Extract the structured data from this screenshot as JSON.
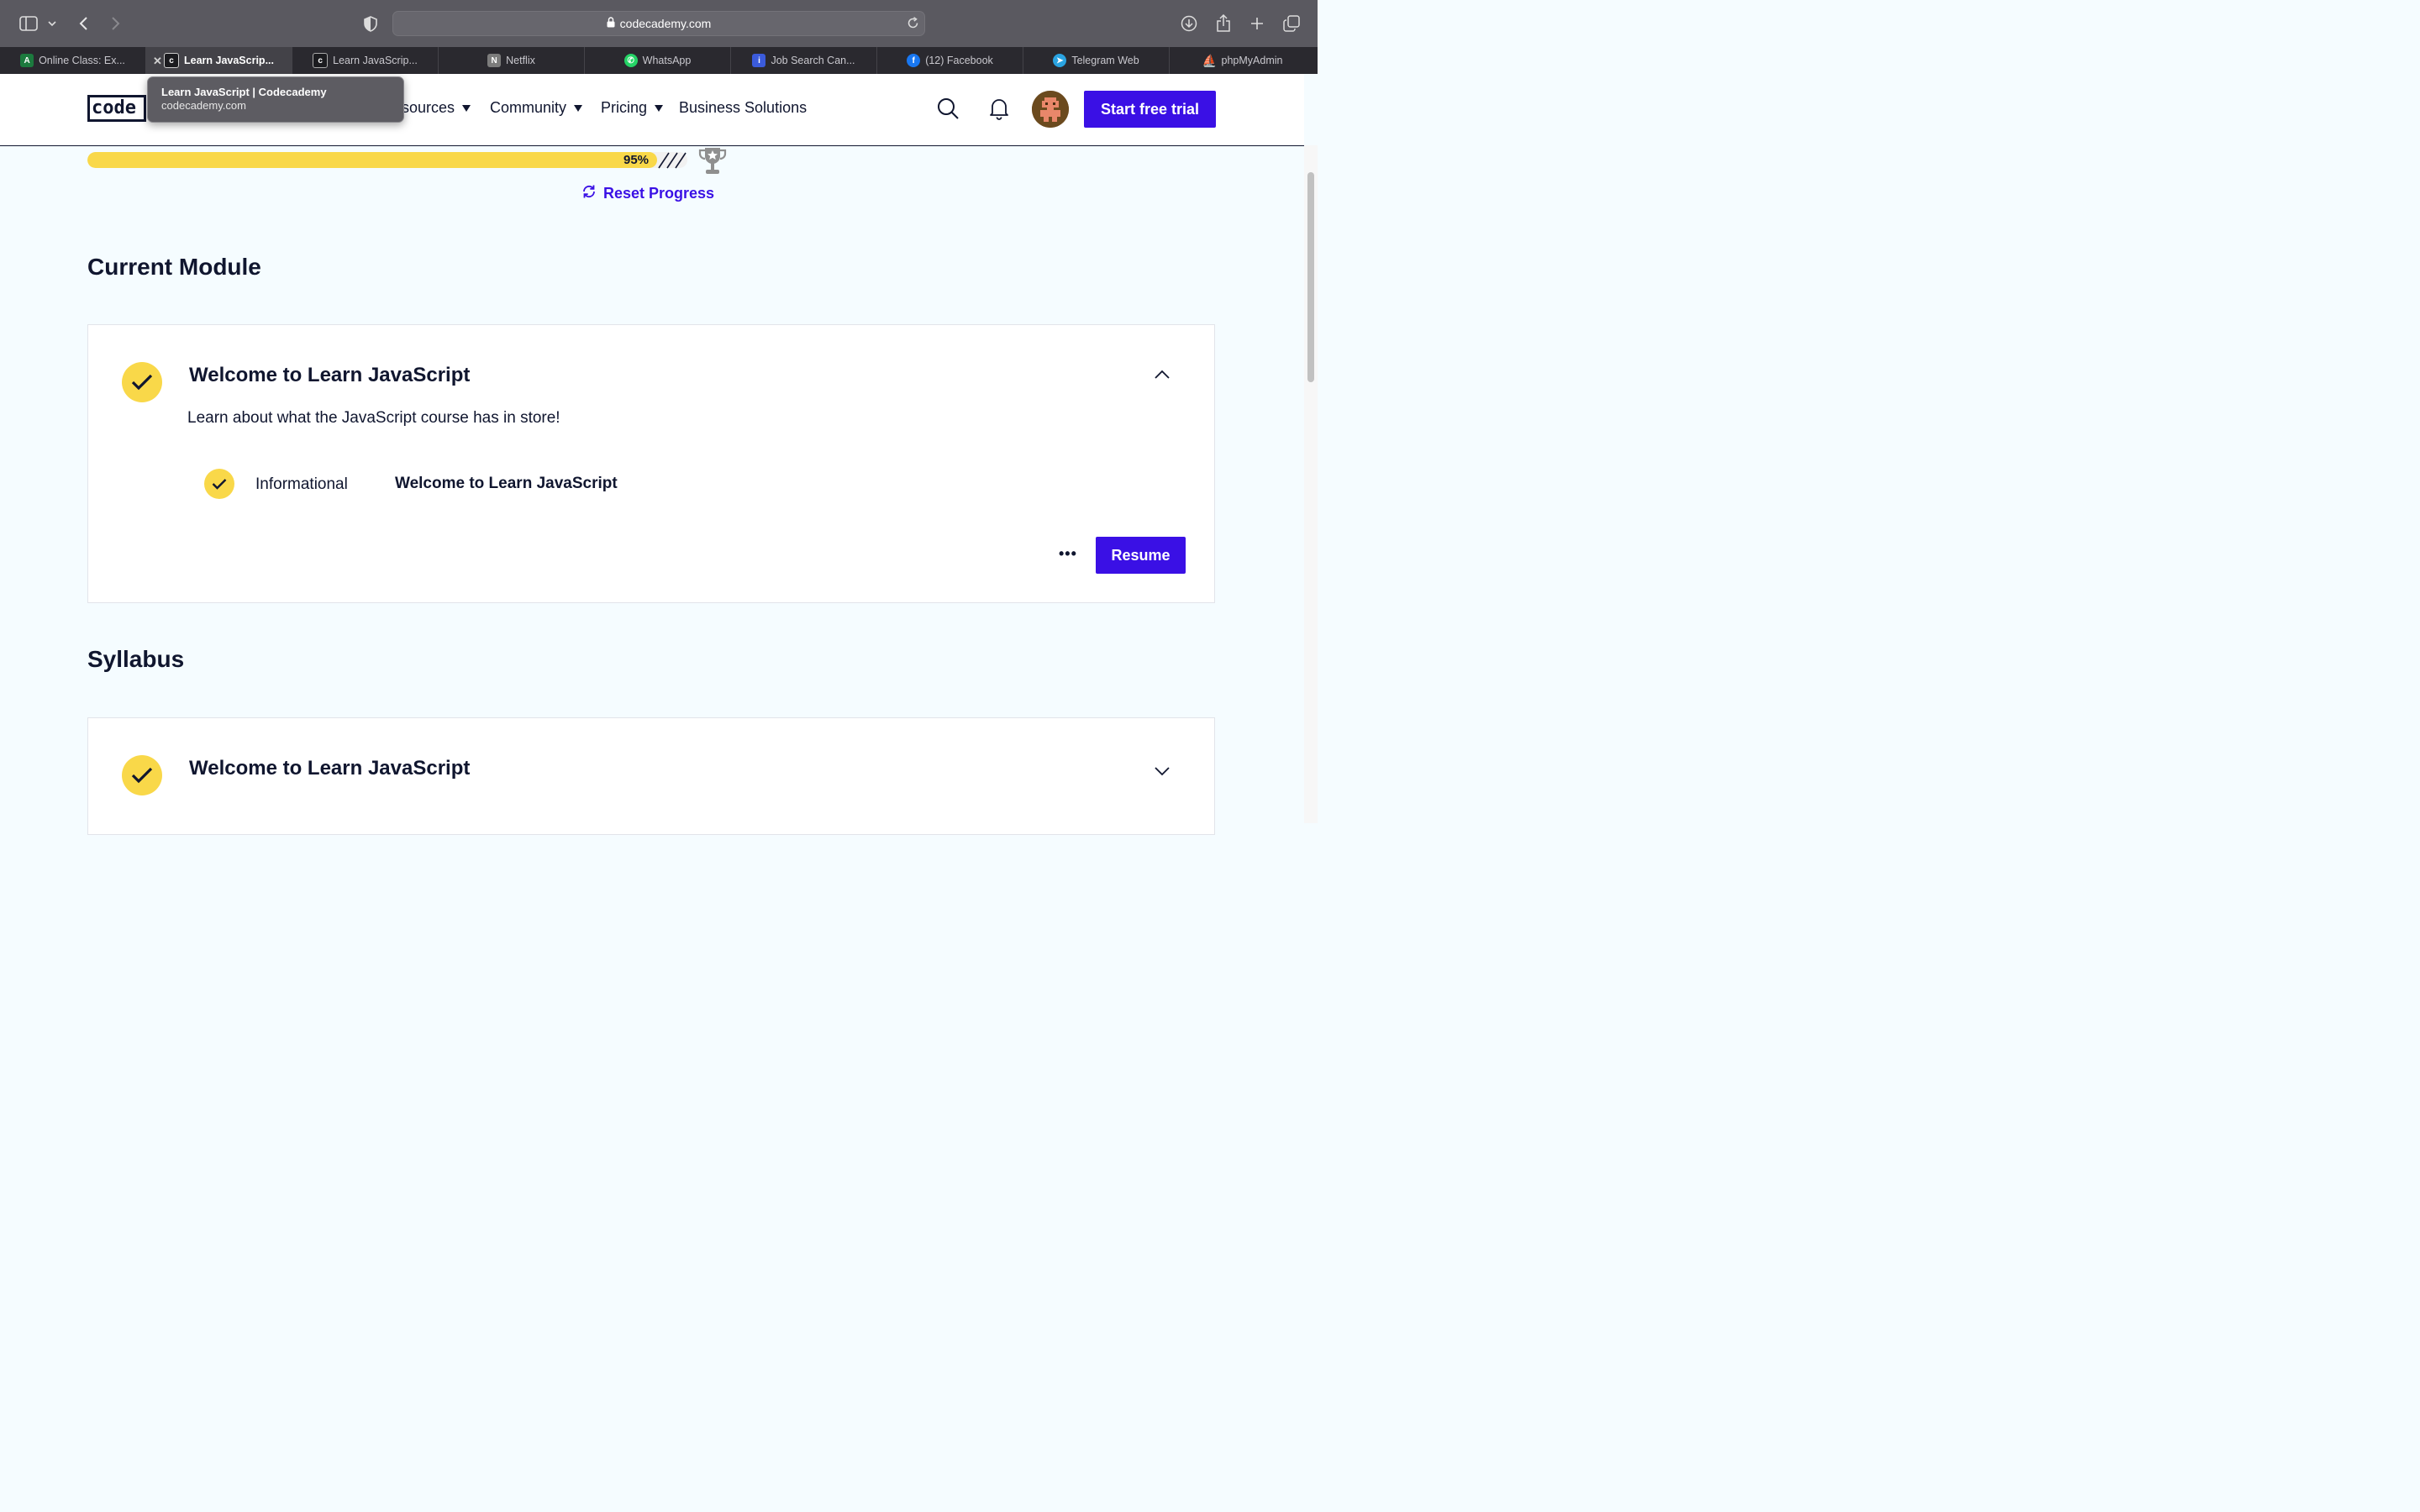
{
  "browser": {
    "url": "codecademy.com",
    "tabs": [
      {
        "label": "Online Class: Ex...",
        "favicon": "AC",
        "favicon_color": "#1c7a3e"
      },
      {
        "label": "Learn JavaScrip...",
        "favicon": "c",
        "favicon_color": "#2b2b2b",
        "active": true
      },
      {
        "label": "Learn JavaScrip...",
        "favicon": "c",
        "favicon_color": "#2b2b2b"
      },
      {
        "label": "Netflix",
        "favicon": "N",
        "favicon_color": "#7c7c7c"
      },
      {
        "label": "WhatsApp",
        "favicon": "W",
        "favicon_color": "#25d366"
      },
      {
        "label": "Job Search Can...",
        "favicon": "i",
        "favicon_color": "#3b5bdb"
      },
      {
        "label": "(12) Facebook",
        "favicon": "f",
        "favicon_color": "#1877f2"
      },
      {
        "label": "Telegram Web",
        "favicon": "T",
        "favicon_color": "#2aa3e1"
      },
      {
        "label": "phpMyAdmin",
        "favicon": "P",
        "favicon_color": "#f29111"
      }
    ],
    "tooltip": {
      "title": "Learn JavaScript | Codecademy",
      "url": "codecademy.com"
    }
  },
  "header": {
    "logo_text": "code",
    "nav": [
      {
        "label": "Resources",
        "shown": "sources",
        "dropdown": true
      },
      {
        "label": "Community",
        "dropdown": true
      },
      {
        "label": "Pricing",
        "dropdown": true
      },
      {
        "label": "Business Solutions",
        "dropdown": false
      }
    ],
    "cta_label": "Start free trial"
  },
  "progress": {
    "percent_label": "95%",
    "fraction": 0.95,
    "reset_label": "Reset Progress"
  },
  "current_module": {
    "heading": "Current Module",
    "title": "Welcome to Learn JavaScript",
    "description": "Learn about what the JavaScript course has in store!",
    "lesson": {
      "type": "Informational",
      "title": "Welcome to Learn JavaScript"
    },
    "more_label": "•••",
    "resume_label": "Resume"
  },
  "syllabus": {
    "heading": "Syllabus",
    "modules": [
      {
        "title": "Welcome to Learn JavaScript"
      }
    ]
  },
  "colors": {
    "accent": "#3a10e5",
    "yellow": "#f9d849",
    "navy": "#10162f"
  }
}
